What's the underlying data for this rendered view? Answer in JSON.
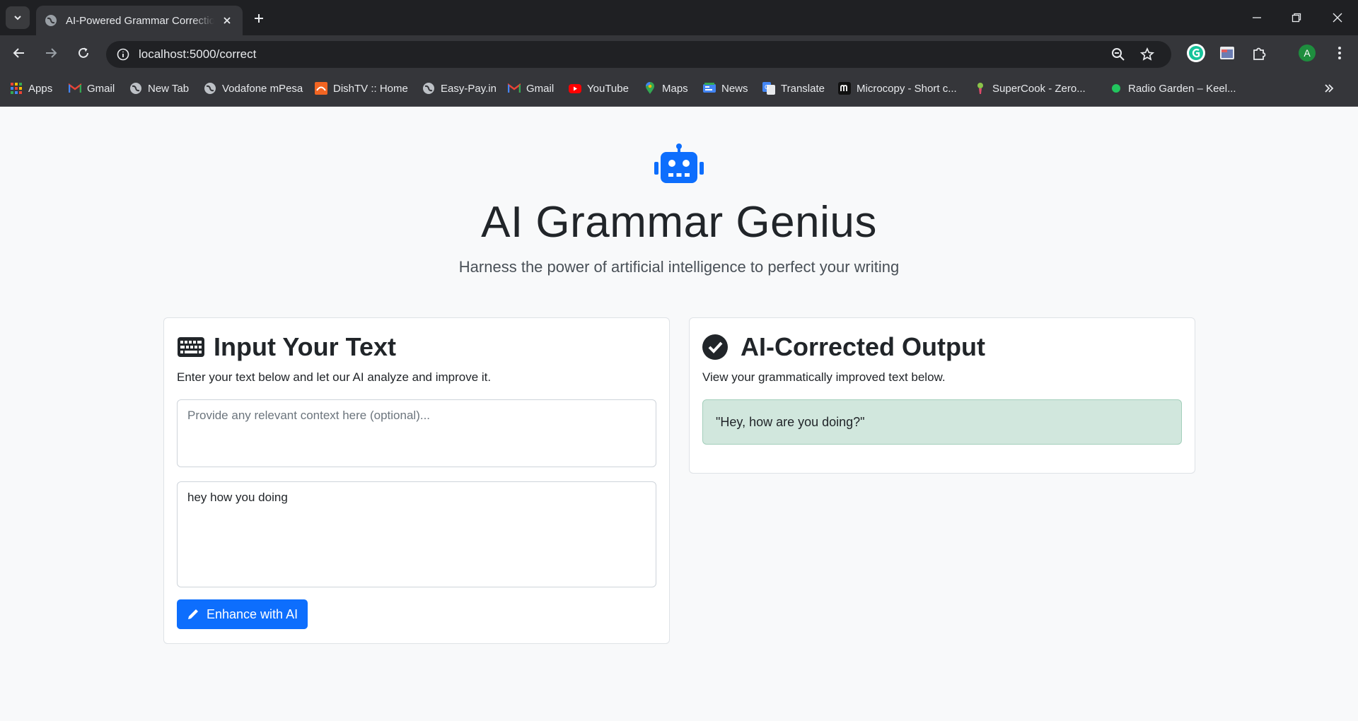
{
  "browser": {
    "tab_title": "AI-Powered Grammar Correction",
    "url": "localhost:5000/correct",
    "profile_initial": "A",
    "bookmarks": [
      {
        "label": "Apps",
        "icon": "apps-grid-icon"
      },
      {
        "label": "Gmail",
        "icon": "gmail-icon"
      },
      {
        "label": "New Tab",
        "icon": "globe-icon"
      },
      {
        "label": "Vodafone mPesa",
        "icon": "globe-icon"
      },
      {
        "label": "DishTV :: Home",
        "icon": "dishtv-icon"
      },
      {
        "label": "Easy-Pay.in",
        "icon": "globe-icon"
      },
      {
        "label": "Gmail",
        "icon": "gmail-icon"
      },
      {
        "label": "YouTube",
        "icon": "youtube-icon"
      },
      {
        "label": "Maps",
        "icon": "maps-pin-icon"
      },
      {
        "label": "News",
        "icon": "news-icon"
      },
      {
        "label": "Translate",
        "icon": "translate-icon"
      },
      {
        "label": "Microcopy - Short c...",
        "icon": "microcopy-icon"
      },
      {
        "label": "SuperCook - Zero...",
        "icon": "supercook-icon"
      },
      {
        "label": "Radio Garden – Keel...",
        "icon": "radio-garden-icon"
      }
    ]
  },
  "header": {
    "title": "AI Grammar Genius",
    "subtitle": "Harness the power of artificial intelligence to perfect your writing"
  },
  "input_card": {
    "heading": "Input Your Text",
    "description": "Enter your text below and let our AI analyze and improve it.",
    "context_placeholder": "Provide any relevant context here (optional)...",
    "context_value": "",
    "text_value": "hey how you doing",
    "button_label": "Enhance with AI"
  },
  "output_card": {
    "heading": "AI-Corrected Output",
    "description": "View your grammatically improved text below.",
    "result": "\"Hey, how are you doing?\""
  },
  "colors": {
    "accent": "#0d6efd",
    "success_bg": "#d1e7dd",
    "chrome_dark": "#35363a"
  }
}
